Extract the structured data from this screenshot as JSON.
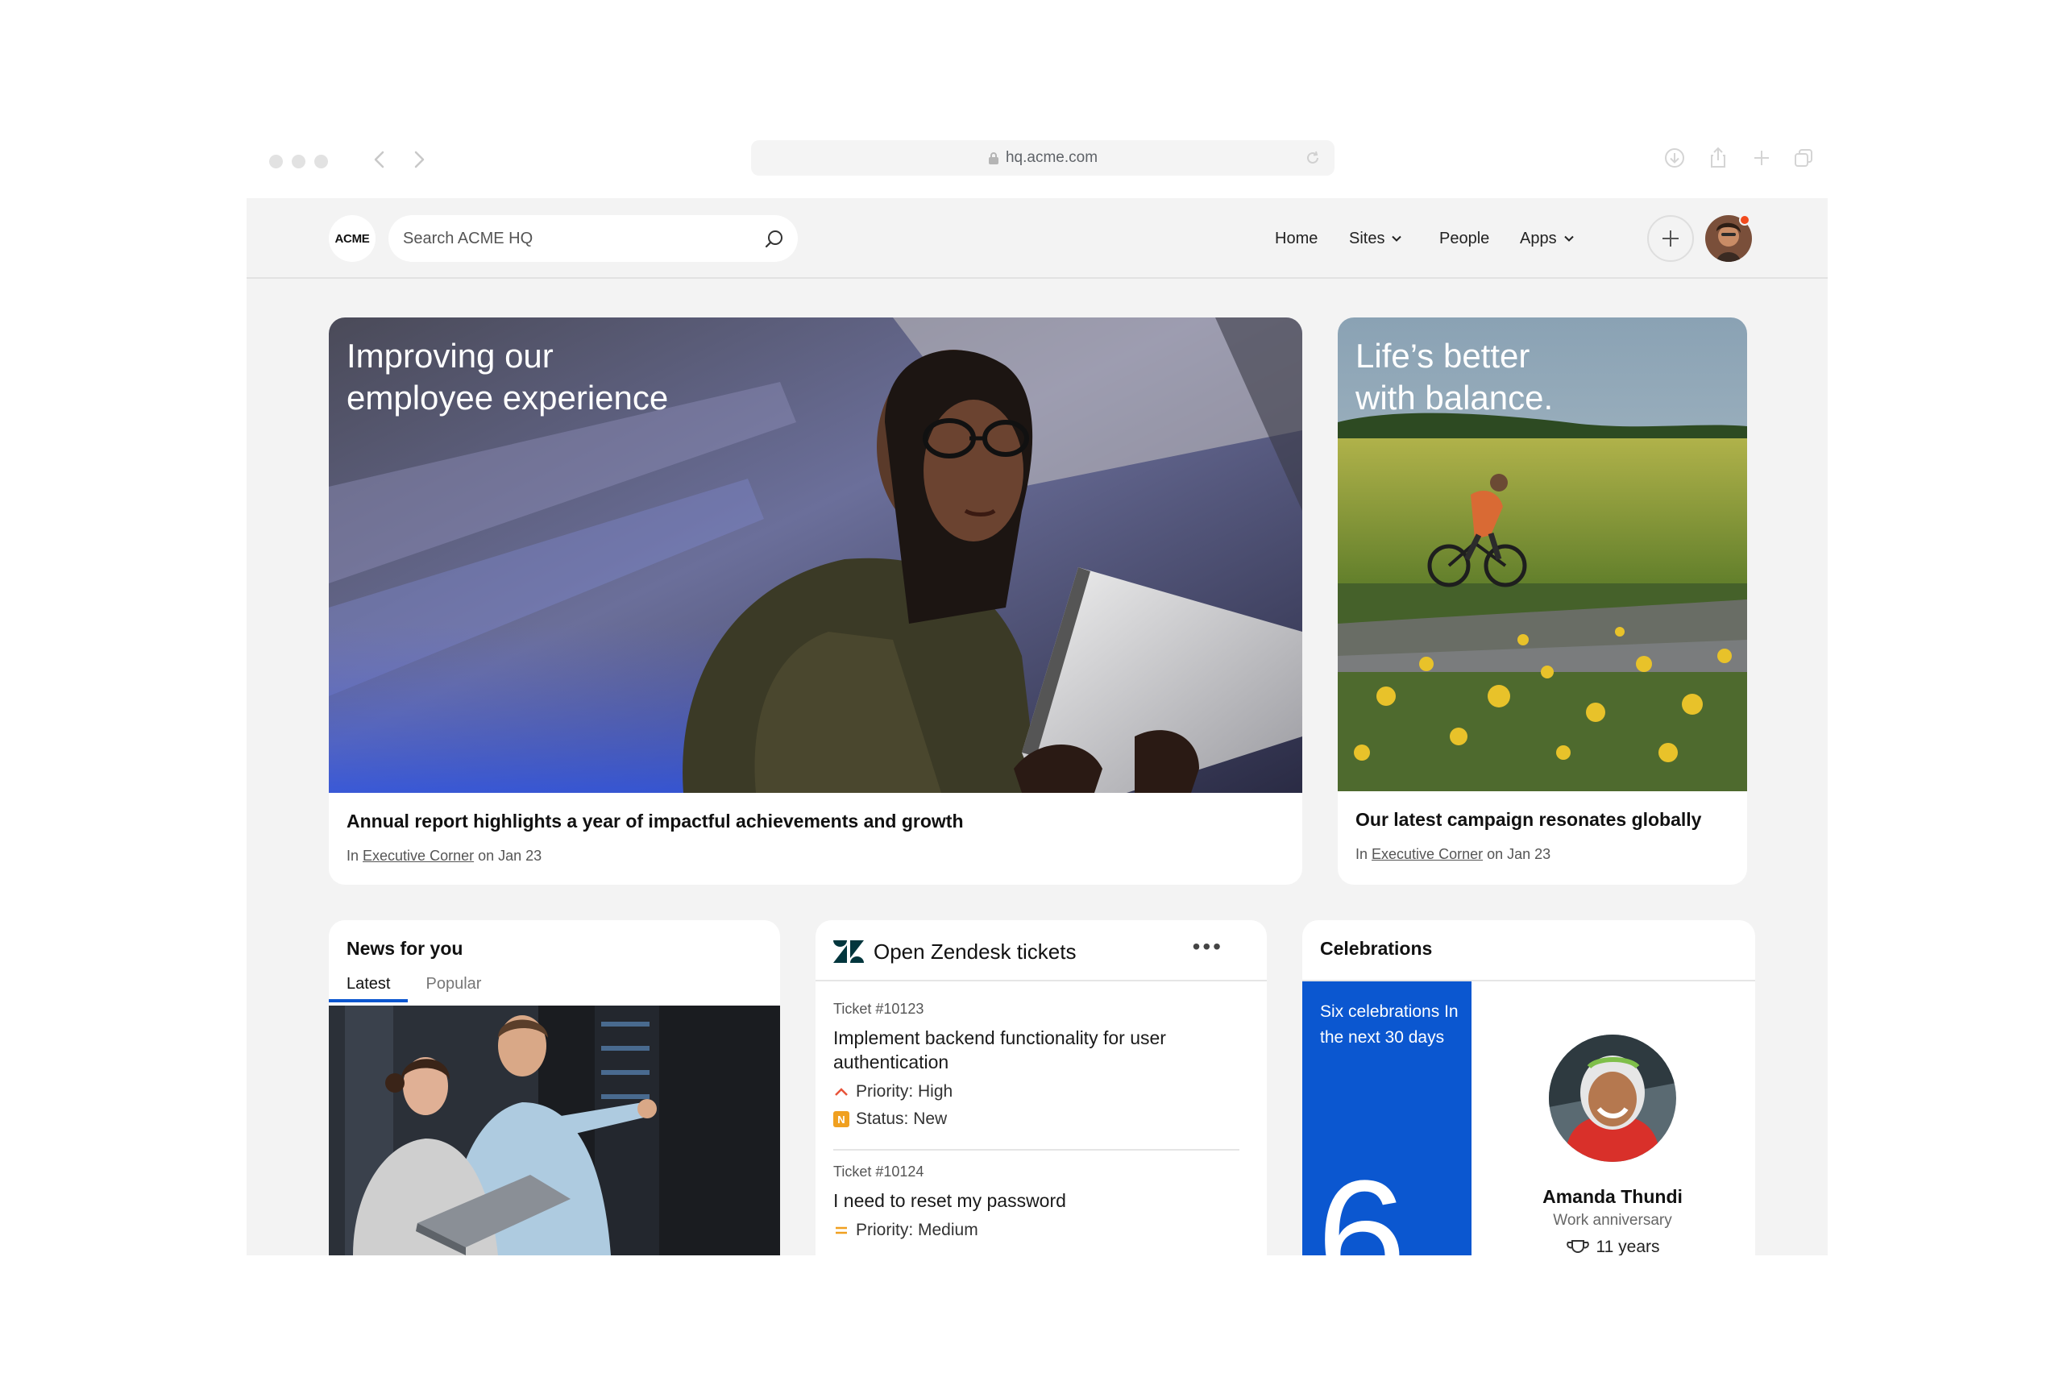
{
  "browser": {
    "url": "hq.acme.com"
  },
  "header": {
    "logo": "ACME",
    "search_placeholder": "Search ACME HQ",
    "nav": {
      "home": "Home",
      "sites": "Sites",
      "people": "People",
      "apps": "Apps"
    }
  },
  "featured": {
    "main": {
      "title_line1": "Improving our",
      "title_line2": "employee experience",
      "headline": "Annual report highlights a year of impactful achievements and growth",
      "meta_prefix": "In",
      "meta_link": "Executive Corner",
      "meta_date": "on Jan 23"
    },
    "side": {
      "title_line1": "Life’s better",
      "title_line2": "with balance.",
      "headline": "Our latest campaign resonates globally",
      "meta_prefix": "In",
      "meta_link": "Executive Corner",
      "meta_date": "on Jan 23"
    }
  },
  "news": {
    "title": "News for you",
    "tabs": [
      "Latest",
      "Popular"
    ]
  },
  "zendesk": {
    "title": "Open Zendesk tickets",
    "more": "•••",
    "tickets": [
      {
        "number": "Ticket #10123",
        "title": "Implement backend functionality for user authentication",
        "priority": "Priority: High",
        "status": "Status: New",
        "status_badge": "N"
      },
      {
        "number": "Ticket #10124",
        "title": "I need to reset my password",
        "priority": "Priority: Medium"
      }
    ]
  },
  "celebrations": {
    "title": "Celebrations",
    "summary": "Six celebrations In the next 30 days",
    "count": "6",
    "person": {
      "name": "Amanda Thundi",
      "occasion": "Work anniversary",
      "years": "11 years"
    }
  },
  "colors": {
    "accent": "#0b57d0",
    "notification": "#f24a1d",
    "priority_high": "#e8543a",
    "priority_medium": "#f0a020",
    "status_new": "#f0a020"
  }
}
